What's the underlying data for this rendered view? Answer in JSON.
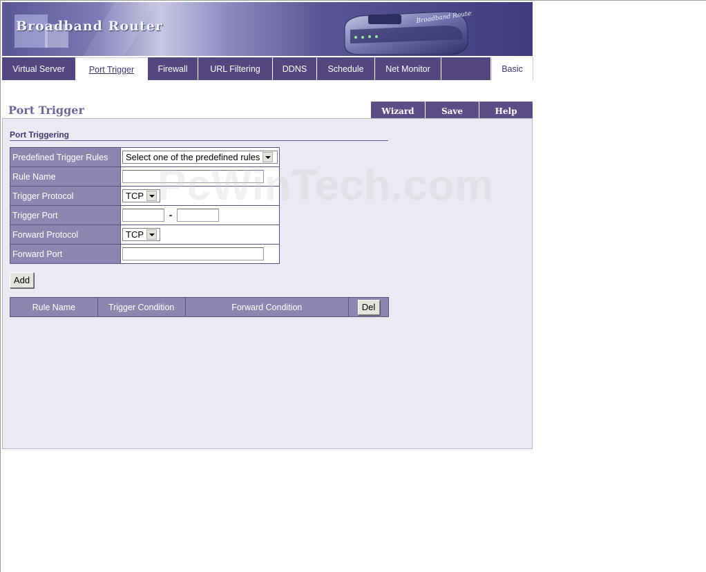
{
  "banner": {
    "title": "Broadband Router",
    "router_label": "Broadband Router"
  },
  "tabs": [
    {
      "label": "Virtual Server",
      "active": false
    },
    {
      "label": "Port Trigger",
      "active": true
    },
    {
      "label": "Firewall",
      "active": false
    },
    {
      "label": "URL Filtering",
      "active": false
    },
    {
      "label": "DDNS",
      "active": false
    },
    {
      "label": "Schedule",
      "active": false
    },
    {
      "label": "Net Monitor",
      "active": false
    },
    {
      "label": "",
      "active": false
    },
    {
      "label": "Basic",
      "active": false
    }
  ],
  "page": {
    "title": "Port Trigger",
    "actions": {
      "wizard": "Wizard",
      "save": "Save",
      "help": "Help"
    }
  },
  "section": {
    "title": "Port Triggering"
  },
  "form": {
    "predefined_label": "Predefined Trigger Rules",
    "predefined_value": "Select one of the predefined rules",
    "rule_name_label": "Rule Name",
    "rule_name_value": "",
    "trigger_protocol_label": "Trigger Protocol",
    "trigger_protocol_value": "TCP",
    "trigger_port_label": "Trigger Port",
    "trigger_port_start": "",
    "trigger_port_separator": "-",
    "trigger_port_end": "",
    "forward_protocol_label": "Forward Protocol",
    "forward_protocol_value": "TCP",
    "forward_port_label": "Forward Port",
    "forward_port_value": ""
  },
  "buttons": {
    "add": "Add",
    "del": "Del"
  },
  "list": {
    "headers": [
      "Rule Name",
      "Trigger Condition",
      "Forward Condition"
    ]
  },
  "watermark": "PcWinTech.com",
  "colors": {
    "accent": "#54477f",
    "label_bg": "#8e86b0",
    "panel_bg": "#ebeaf2"
  }
}
